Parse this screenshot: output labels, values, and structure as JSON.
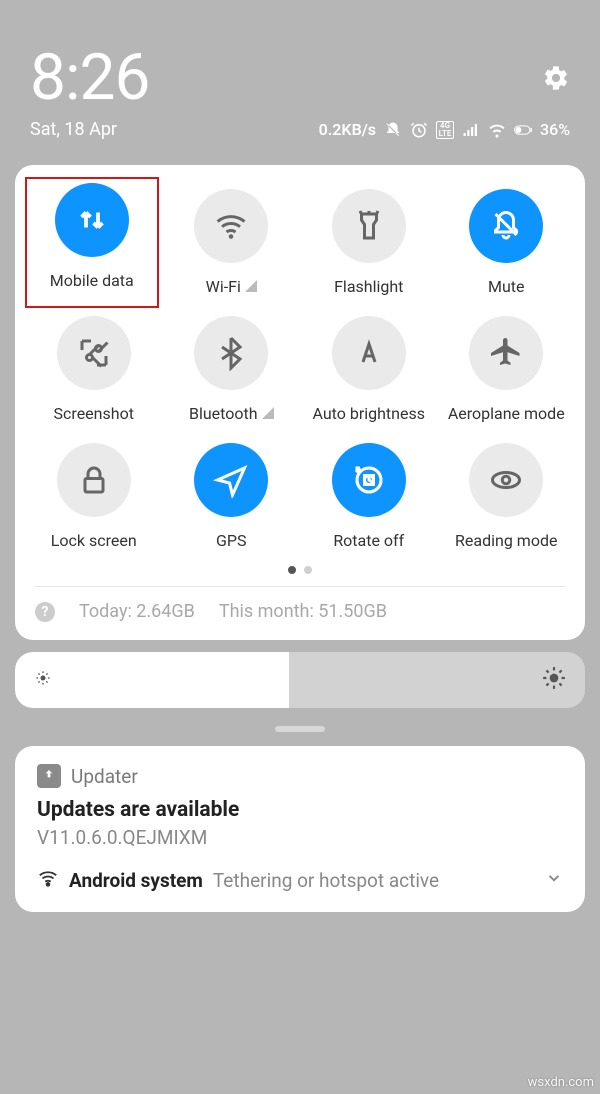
{
  "status": {
    "time": "8:26",
    "date": "Sat, 18 Apr",
    "network_speed": "0.2KB/s",
    "battery_text": "36%",
    "lte_label": "4G LTE"
  },
  "quick_settings": {
    "tiles": [
      {
        "label": "Mobile data",
        "icon": "mobile-data-icon",
        "active": true,
        "expandable": false,
        "highlighted": true
      },
      {
        "label": "Wi-Fi",
        "icon": "wifi-icon",
        "active": false,
        "expandable": true
      },
      {
        "label": "Flashlight",
        "icon": "flashlight-icon",
        "active": false,
        "expandable": false
      },
      {
        "label": "Mute",
        "icon": "mute-icon",
        "active": true,
        "expandable": false
      },
      {
        "label": "Screenshot",
        "icon": "screenshot-icon",
        "active": false,
        "expandable": false
      },
      {
        "label": "Bluetooth",
        "icon": "bluetooth-icon",
        "active": false,
        "expandable": true
      },
      {
        "label": "Auto brightness",
        "icon": "auto-brightness-icon",
        "active": false,
        "expandable": false
      },
      {
        "label": "Aeroplane mode",
        "icon": "airplane-icon",
        "active": false,
        "expandable": false
      },
      {
        "label": "Lock screen",
        "icon": "lock-icon",
        "active": false,
        "expandable": false
      },
      {
        "label": "GPS",
        "icon": "gps-icon",
        "active": true,
        "expandable": false
      },
      {
        "label": "Rotate off",
        "icon": "rotate-icon",
        "active": true,
        "expandable": false
      },
      {
        "label": "Reading mode",
        "icon": "reading-icon",
        "active": false,
        "expandable": false
      }
    ],
    "today_label": "Today: 2.64GB",
    "month_label": "This month: 51.50GB"
  },
  "brightness": {
    "value_percent": 48
  },
  "notifications": {
    "updater": {
      "app": "Updater",
      "title": "Updates are available",
      "body": "V11.0.6.0.QEJMIXM"
    },
    "system": {
      "app": "Android system",
      "text": "Tethering or hotspot active"
    }
  },
  "watermark": "wsxdn.com"
}
